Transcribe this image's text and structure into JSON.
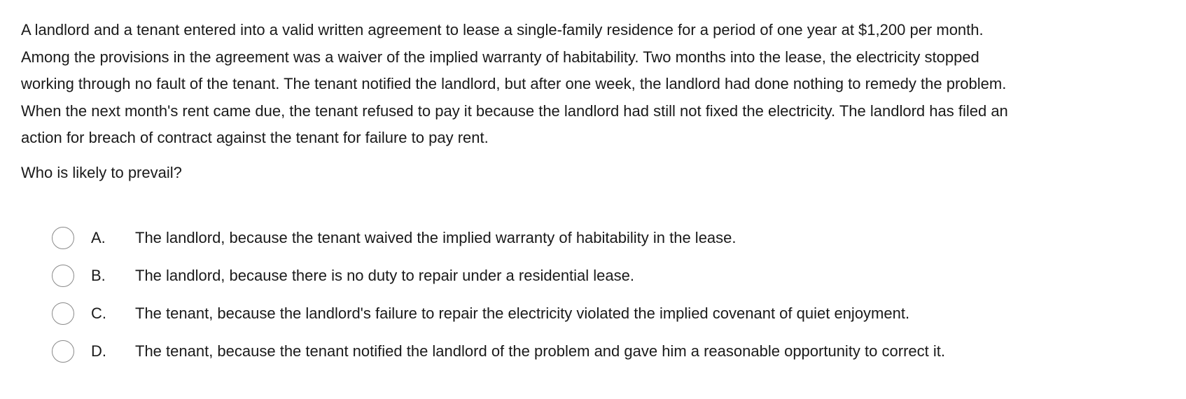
{
  "stem": {
    "lines": [
      "A landlord and a tenant entered into a valid written agreement to lease a single-family residence for a period of one year at $1,200 per month.",
      "Among the provisions in the agreement was a waiver of the implied warranty of habitability.  Two months into the lease, the electricity stopped",
      "working through no fault of the tenant.  The tenant notified the landlord, but after one week, the landlord had done nothing to remedy the problem.",
      "When the next month's rent came due, the tenant refused to pay it because the landlord had still not fixed the electricity.  The landlord has filed an",
      "action for breach of contract against the tenant for failure to pay rent."
    ]
  },
  "question": "Who is likely to prevail?",
  "choices": [
    {
      "letter": "A.",
      "text": "The landlord, because the tenant waived the implied warranty of habitability in the lease.",
      "selected": false
    },
    {
      "letter": "B.",
      "text": "The landlord, because there is no duty to repair under a residential lease.",
      "selected": false
    },
    {
      "letter": "C.",
      "text": "The tenant, because the landlord's failure to repair the electricity violated the implied covenant of quiet enjoyment.",
      "selected": false
    },
    {
      "letter": "D.",
      "text": "The tenant, because the tenant notified the landlord of the problem and gave him a reasonable opportunity to correct it.",
      "selected": false
    }
  ]
}
